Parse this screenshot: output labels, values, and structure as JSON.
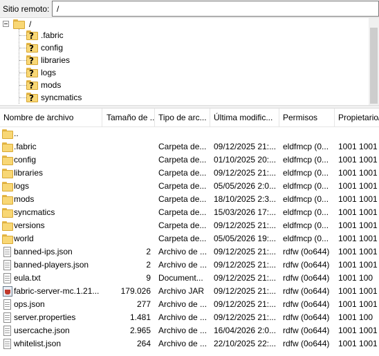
{
  "remote_site": {
    "label": "Sitio remoto:",
    "path": "/"
  },
  "tree": {
    "root": "/",
    "children": [
      ".fabric",
      "config",
      "libraries",
      "logs",
      "mods",
      "syncmatics"
    ]
  },
  "columns": [
    "Nombre de archivo",
    "Tamaño de ...",
    "Tipo de arc...",
    "Última modific...",
    "Permisos",
    "Propietario/..."
  ],
  "rows": [
    {
      "name": "..",
      "size": "",
      "type": "",
      "modified": "",
      "perms": "",
      "owner": "",
      "icon": "folder-icon"
    },
    {
      "name": ".fabric",
      "size": "",
      "type": "Carpeta de...",
      "modified": "09/12/2025 21:...",
      "perms": "eldfmcp (0...",
      "owner": "1001 1001",
      "icon": "folder-icon"
    },
    {
      "name": "config",
      "size": "",
      "type": "Carpeta de...",
      "modified": "01/10/2025 20:...",
      "perms": "eldfmcp (0...",
      "owner": "1001 1001",
      "icon": "folder-icon"
    },
    {
      "name": "libraries",
      "size": "",
      "type": "Carpeta de...",
      "modified": "09/12/2025 21:...",
      "perms": "eldfmcp (0...",
      "owner": "1001 1001",
      "icon": "folder-icon"
    },
    {
      "name": "logs",
      "size": "",
      "type": "Carpeta de...",
      "modified": "05/05/2026 2:0...",
      "perms": "eldfmcp (0...",
      "owner": "1001 1001",
      "icon": "folder-icon"
    },
    {
      "name": "mods",
      "size": "",
      "type": "Carpeta de...",
      "modified": "18/10/2025 2:3...",
      "perms": "eldfmcp (0...",
      "owner": "1001 1001",
      "icon": "folder-icon"
    },
    {
      "name": "syncmatics",
      "size": "",
      "type": "Carpeta de...",
      "modified": "15/03/2026 17:...",
      "perms": "eldfmcp (0...",
      "owner": "1001 1001",
      "icon": "folder-icon"
    },
    {
      "name": "versions",
      "size": "",
      "type": "Carpeta de...",
      "modified": "09/12/2025 21:...",
      "perms": "eldfmcp (0...",
      "owner": "1001 1001",
      "icon": "folder-icon"
    },
    {
      "name": "world",
      "size": "",
      "type": "Carpeta de...",
      "modified": "05/05/2026 19:...",
      "perms": "eldfmcp (0...",
      "owner": "1001 1001",
      "icon": "folder-icon"
    },
    {
      "name": "banned-ips.json",
      "size": "2",
      "type": "Archivo de ...",
      "modified": "09/12/2025 21:...",
      "perms": "rdfw (0o644)",
      "owner": "1001 1001",
      "icon": "file-icon"
    },
    {
      "name": "banned-players.json",
      "size": "2",
      "type": "Archivo de ...",
      "modified": "09/12/2025 21:...",
      "perms": "rdfw (0o644)",
      "owner": "1001 1001",
      "icon": "file-icon"
    },
    {
      "name": "eula.txt",
      "size": "9",
      "type": "Document...",
      "modified": "09/12/2025 21:...",
      "perms": "rdfw (0o644)",
      "owner": "1001 100",
      "icon": "text-file-icon"
    },
    {
      "name": "fabric-server-mc.1.21...",
      "size": "179.026",
      "type": "Archivo JAR",
      "modified": "09/12/2025 21:...",
      "perms": "rdfw (0o644)",
      "owner": "1001 1001",
      "icon": "jar-file-icon"
    },
    {
      "name": "ops.json",
      "size": "277",
      "type": "Archivo de ...",
      "modified": "09/12/2025 21:...",
      "perms": "rdfw (0o644)",
      "owner": "1001 1001",
      "icon": "file-icon"
    },
    {
      "name": "server.properties",
      "size": "1.481",
      "type": "Archivo de ...",
      "modified": "09/12/2025 21:...",
      "perms": "rdfw (0o644)",
      "owner": "1001 100",
      "icon": "file-icon"
    },
    {
      "name": "usercache.json",
      "size": "2.965",
      "type": "Archivo de ...",
      "modified": "16/04/2026 2:0...",
      "perms": "rdfw (0o644)",
      "owner": "1001 1001",
      "icon": "file-icon"
    },
    {
      "name": "whitelist.json",
      "size": "264",
      "type": "Archivo de ...",
      "modified": "22/10/2025 22:...",
      "perms": "rdfw (0o644)",
      "owner": "1001 1001",
      "icon": "file-icon"
    }
  ]
}
